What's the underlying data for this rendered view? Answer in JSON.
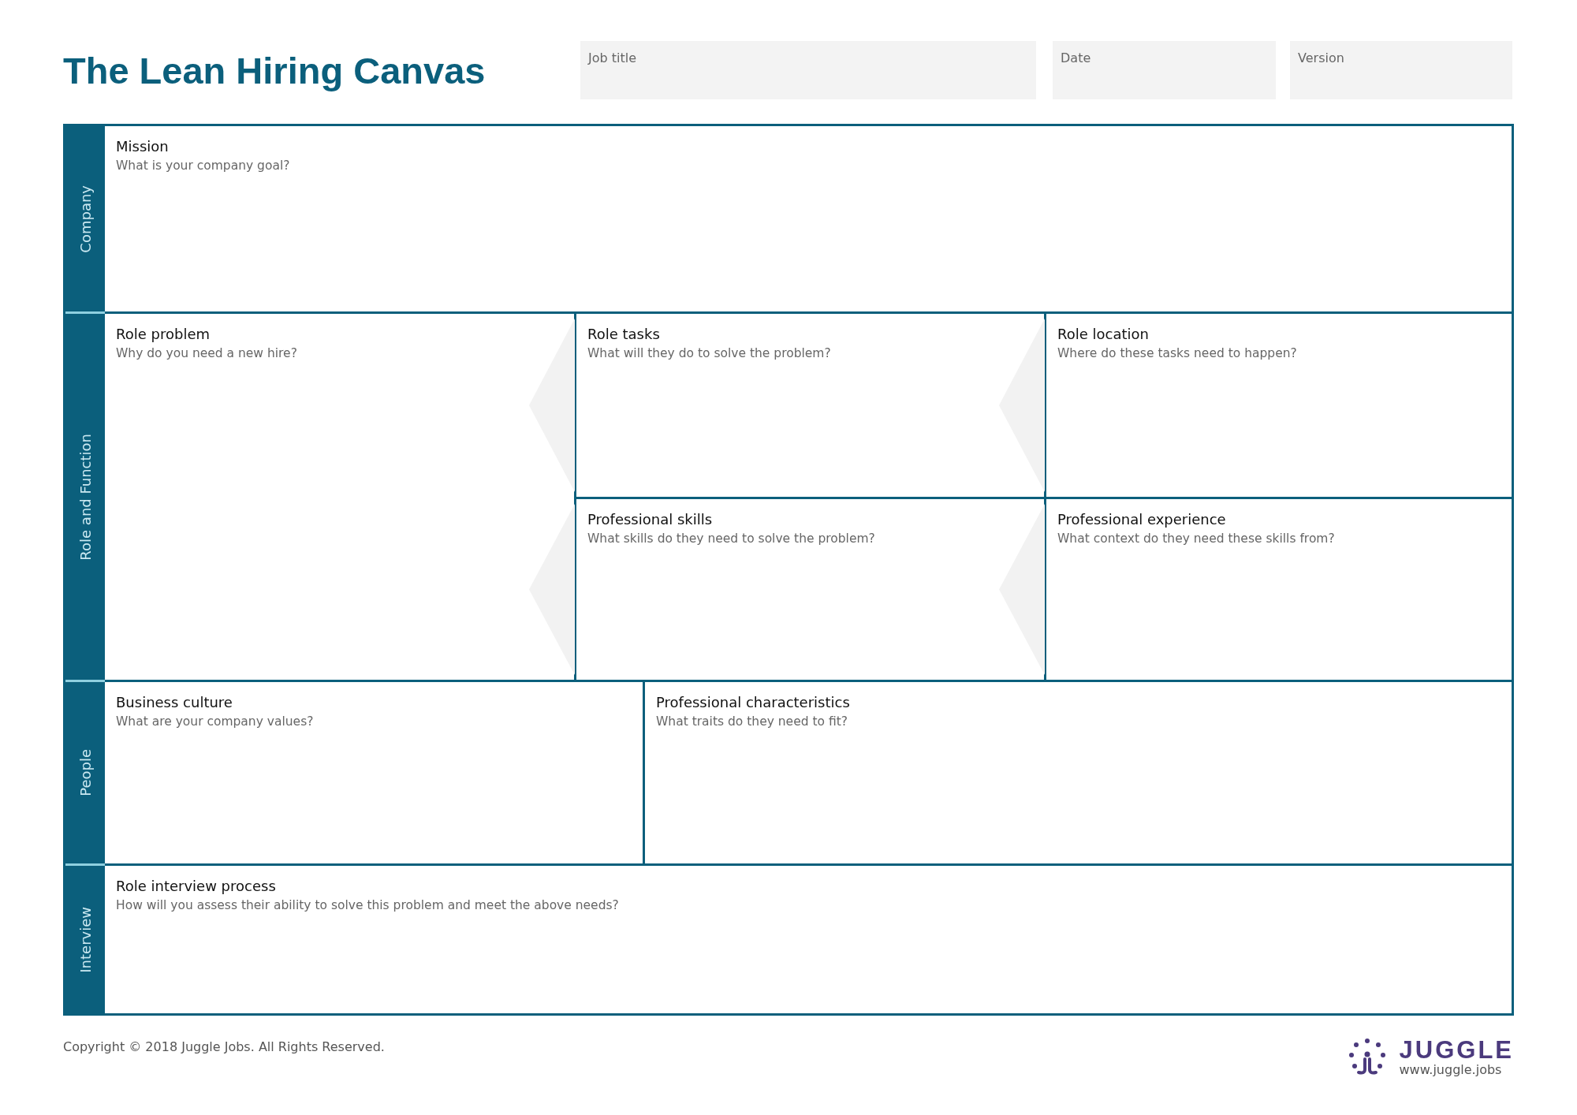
{
  "title": "The Lean Hiring Canvas",
  "header_fields": [
    {
      "placeholder": "Job title"
    },
    {
      "placeholder": "Date"
    },
    {
      "placeholder": "Version"
    }
  ],
  "sections": [
    {
      "label": "Company",
      "kind": "single",
      "blocks": [
        {
          "title": "Mission",
          "prompt": "What is your company goal?"
        }
      ]
    },
    {
      "label": "Role and Function",
      "kind": "grid",
      "blocks": [
        {
          "title": "Role problem",
          "prompt": "Why do you need a new hire?"
        },
        {
          "title": "Role tasks",
          "prompt": "What will they do to solve the problem?"
        },
        {
          "title": "Role location",
          "prompt": "Where do these tasks need to happen?"
        },
        {
          "title": "Professional skills",
          "prompt": "What skills do they need to solve the problem?"
        },
        {
          "title": "Professional experience",
          "prompt": "What context do they need these skills from?"
        }
      ]
    },
    {
      "label": "People",
      "kind": "split",
      "blocks": [
        {
          "title": "Business culture",
          "prompt": "What are your company values?"
        },
        {
          "title": "Professional characteristics",
          "prompt": "What traits do they need to fit?"
        }
      ]
    },
    {
      "label": "Interview",
      "kind": "single",
      "blocks": [
        {
          "title": "Role interview process",
          "prompt": "How will you assess their ability to solve this problem and meet the above needs?"
        }
      ]
    }
  ],
  "footer": {
    "copyright": "Copyright © 2018 Juggle Jobs. All Rights Reserved.",
    "brand": "JUGGLE",
    "url": "www.juggle.jobs"
  }
}
